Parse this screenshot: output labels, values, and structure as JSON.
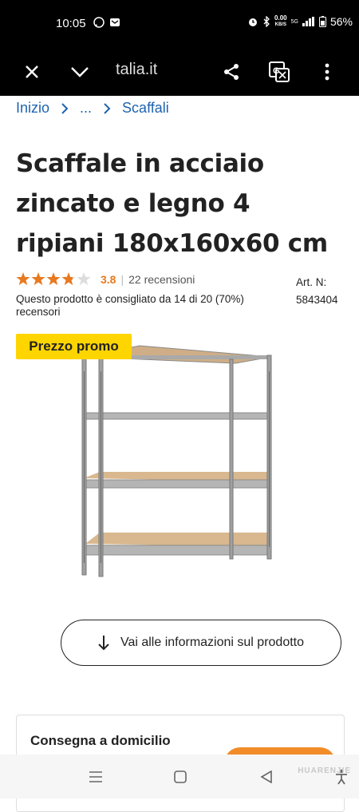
{
  "status_bar": {
    "time": "10:05",
    "net_speed_value": "0.00",
    "net_speed_unit": "KB/S",
    "signal_label": "5G",
    "battery": "56%"
  },
  "browser": {
    "url": "talia.it",
    "icons": [
      "close-icon",
      "chevron-down-icon",
      "share-icon",
      "translate-icon",
      "more-vert-icon"
    ]
  },
  "breadcrumb": {
    "items": [
      "Inizio",
      "...",
      "Scaffali"
    ]
  },
  "product": {
    "title": "Scaffale in acciaio zincato e legno 4 ripiani 180x160x60 cm",
    "rating_value": "3.8",
    "rating_stars": 3.8,
    "reviews": "22 recensioni",
    "recommendation": "Questo prodotto è consigliato da 14 di 20 (70%) recensori",
    "art_label": "Art. N:",
    "art_number": "5843404",
    "promo_badge": "Prezzo promo",
    "info_button": "Vai alle informazioni sul prodotto"
  },
  "delivery": {
    "title": "Consegna a domicilio"
  },
  "watermark": "HUARENJIE",
  "colors": {
    "link": "#1e63b0",
    "star": "#e8791f",
    "promo": "#ffd500",
    "accent": "#f28c28"
  }
}
